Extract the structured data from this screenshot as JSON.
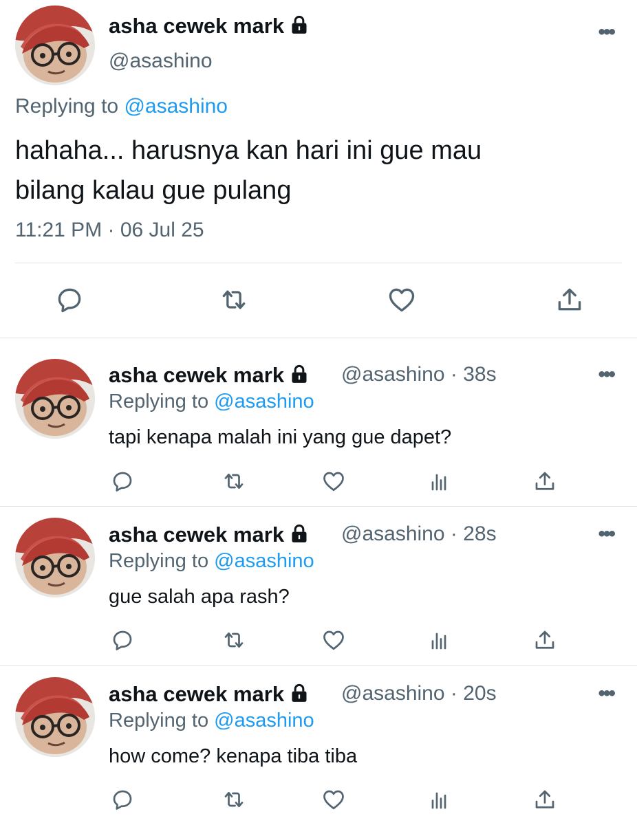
{
  "main_tweet": {
    "author_name": "asha cewek mark",
    "author_handle": "@asashino",
    "replying_prefix": "Replying to",
    "replying_to": "@asashino",
    "text_line1": "hahaha... harusnya kan hari ini gue mau",
    "text_line2": "bilang kalau gue pulang",
    "timestamp": "11:21 PM · 06 Jul 25",
    "more_label": "•••"
  },
  "replies": [
    {
      "author_name": "asha cewek mark",
      "handle_time": "@asashino · 38s",
      "replying_prefix": "Replying to",
      "replying_to": "@asashino",
      "text": "tapi kenapa malah ini yang gue dapet?",
      "more_label": "•••"
    },
    {
      "author_name": "asha cewek mark",
      "handle_time": "@asashino · 28s",
      "replying_prefix": "Replying to",
      "replying_to": "@asashino",
      "text": "gue salah apa rash?",
      "more_label": "•••"
    },
    {
      "author_name": "asha cewek mark",
      "handle_time": "@asashino · 20s",
      "replying_prefix": "Replying to",
      "replying_to": "@asashino",
      "text": "how come? kenapa tiba tiba",
      "more_label": "•••"
    }
  ],
  "icons": {
    "reply": "reply-icon",
    "retweet": "retweet-icon",
    "like": "heart-icon",
    "views": "views-icon",
    "share": "share-icon",
    "lock": "lock-icon",
    "more": "more-icon"
  },
  "colors": {
    "text": "#0f1419",
    "secondary": "#536471",
    "link": "#1d9bf0",
    "divider": "#dfe3e6"
  }
}
